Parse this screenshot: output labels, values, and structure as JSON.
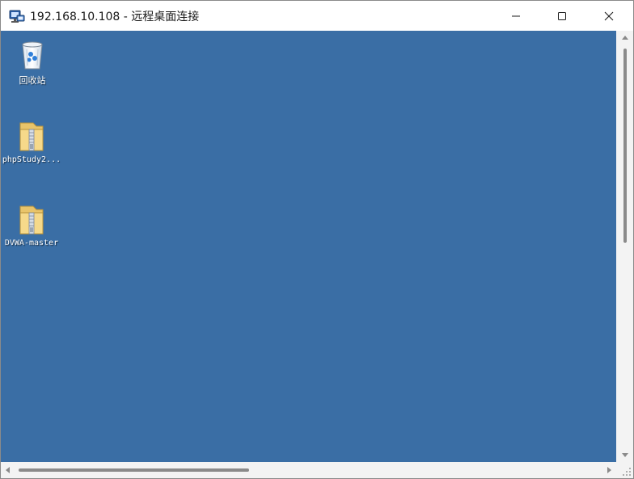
{
  "window": {
    "title": "192.168.10.108 - 远程桌面连接",
    "app_icon": "remote-desktop-icon",
    "buttons": {
      "minimize": "minimize-icon",
      "maximize": "maximize-icon",
      "close": "close-icon"
    }
  },
  "desktop": {
    "background_color": "#3a6ea5",
    "icons": [
      {
        "label": "回收站",
        "icon": "recycle-bin-icon"
      },
      {
        "label": "phpStudy2...",
        "icon": "zip-folder-icon"
      },
      {
        "label": "DVWA-master",
        "icon": "zip-folder-icon"
      }
    ]
  },
  "scrollbars": {
    "vertical": true,
    "horizontal": true
  }
}
